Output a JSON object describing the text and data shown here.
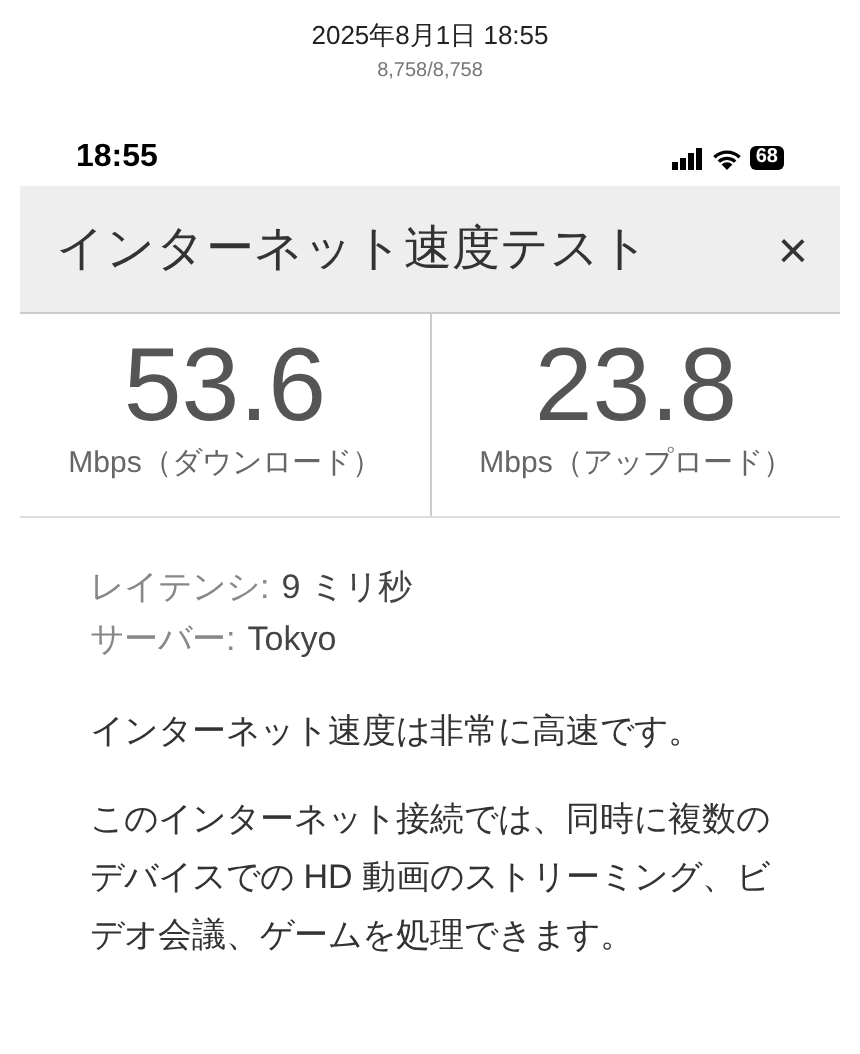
{
  "capture": {
    "datetime": "2025年8月1日 18:55",
    "counter": "8,758/8,758"
  },
  "status_bar": {
    "time": "18:55",
    "battery": "68"
  },
  "panel": {
    "title": "インターネット速度テスト",
    "close": "×"
  },
  "speeds": [
    {
      "value": "53.6",
      "unit": "Mbps（ダウンロード）"
    },
    {
      "value": "23.8",
      "unit": "Mbps（アップロード）"
    }
  ],
  "details": [
    {
      "label": "レイテンシ:",
      "value": "9 ミリ秒"
    },
    {
      "label": "サーバー:",
      "value": "Tokyo"
    }
  ],
  "summary": "インターネット速度は非常に高速です。",
  "description": "このインターネット接続では、同時に複数のデバイスでの HD 動画のストリーミング、ビデオ会議、ゲームを処理できます。"
}
